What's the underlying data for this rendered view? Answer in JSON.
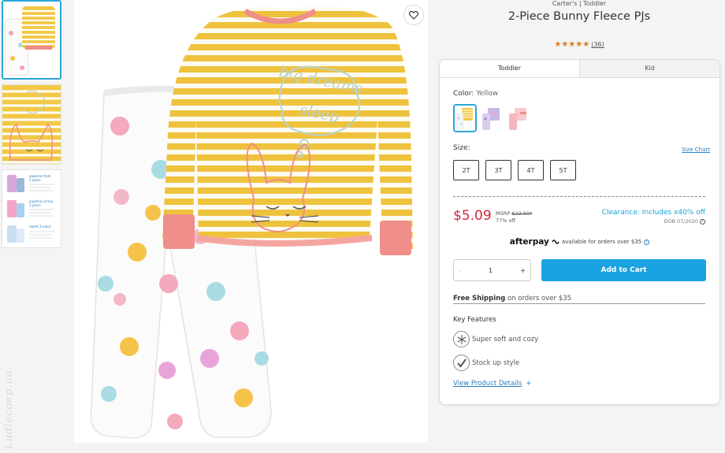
{
  "product": {
    "brand_line": "Carter's | Toddler",
    "title": "2-Piece Bunny Fleece PJs",
    "stars": "★★★★★",
    "review_count": "(36)"
  },
  "tabs": [
    "Toddler",
    "Kid"
  ],
  "color": {
    "label": "Color:",
    "value": "Yellow"
  },
  "size": {
    "label": "Size:",
    "chart_link": "Size Chart",
    "options": [
      "2T",
      "3T",
      "4T",
      "5T"
    ]
  },
  "pricing": {
    "price": "$5.09",
    "msrp_label": "MSRP",
    "msrp_value": "$22.00*",
    "discount": "77% off",
    "clearance": "Clearance: Includes x40% off",
    "dob": "DOB 07/2020"
  },
  "afterpay": {
    "logo": "afterpay",
    "text": "available for orders over $35"
  },
  "quantity": {
    "minus": "-",
    "value": "1",
    "plus": "+"
  },
  "cart_button": "Add to Cart",
  "shipping": {
    "bold": "Free Shipping",
    "rest": "on orders over $35"
  },
  "features": {
    "title": "Key Features",
    "items": [
      "Super soft and cozy",
      "Stock up style"
    ],
    "details_link": "View Product Details",
    "details_plus": "+"
  },
  "thumbnail_caption": {
    "lines": [
      "pajamas from",
      "2-piece",
      "pajamas jersey",
      "2-piece",
      "sweet 2-piece"
    ]
  },
  "print": {
    "shirt_text": "big dreams require sleep"
  },
  "watermark": "Ludlecoep.ua",
  "colors": {
    "accent": "#1aa3e0",
    "price": "#d6263f",
    "stripe": "#efc23d",
    "cuff": "#ef8e8a",
    "rating": "#e07a22"
  }
}
